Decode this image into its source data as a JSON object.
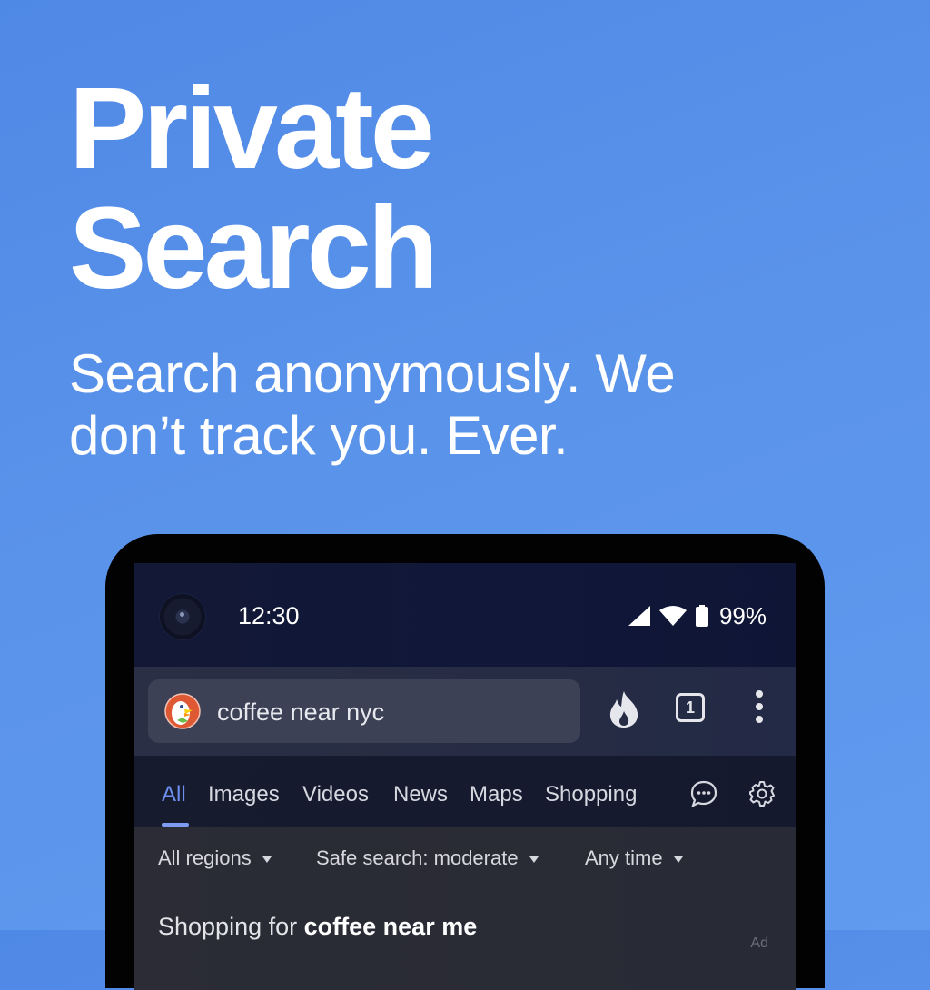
{
  "headline": {
    "line1": "Private",
    "line2": "Search"
  },
  "subheadline": {
    "line1": "Search anonymously. We",
    "line2": "don’t track you. Ever."
  },
  "phone": {
    "status_bar": {
      "time": "12:30",
      "battery_percent": "99%",
      "icons": [
        "signal-icon",
        "wifi-icon",
        "battery-icon"
      ]
    },
    "browser_toolbar": {
      "search_query": "coffee near nyc",
      "logo": "duckduckgo-logo",
      "tab_count": "1",
      "icons": [
        "fire-icon",
        "tabs-icon",
        "overflow-menu-icon"
      ]
    },
    "search_tabs": [
      {
        "label": "All",
        "active": true
      },
      {
        "label": "Images",
        "active": false
      },
      {
        "label": "Videos",
        "active": false
      },
      {
        "label": "News",
        "active": false
      },
      {
        "label": "Maps",
        "active": false
      },
      {
        "label": "Shopping",
        "active": false
      }
    ],
    "nav_icons": [
      "chat-icon",
      "settings-gear-icon"
    ],
    "filters": [
      {
        "label": "All regions"
      },
      {
        "label": "Safe search: moderate"
      },
      {
        "label": "Any time"
      }
    ],
    "results": {
      "shopping_prefix": "Shopping for",
      "shopping_query": "coffee near me",
      "ad_label": "Ad"
    }
  },
  "colors": {
    "background": "#5a93ea",
    "active_tab": "#6d8ff0",
    "status_bar": "#121836",
    "toolbar": "#2a2f45",
    "search_box": "#3d4156"
  }
}
